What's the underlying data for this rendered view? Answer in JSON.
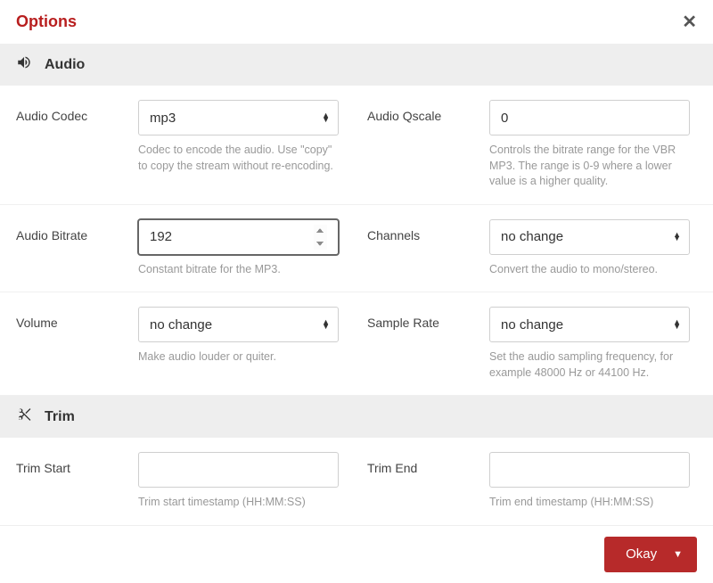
{
  "header": {
    "title": "Options"
  },
  "audio": {
    "section_label": "Audio",
    "codec": {
      "label": "Audio Codec",
      "value": "mp3",
      "help": "Codec to encode the audio. Use \"copy\" to copy the stream without re-encoding."
    },
    "qscale": {
      "label": "Audio Qscale",
      "value": "0",
      "help": "Controls the bitrate range for the VBR MP3. The range is 0-9 where a lower value is a higher quality."
    },
    "bitrate": {
      "label": "Audio Bitrate",
      "value": "192",
      "help": "Constant bitrate for the MP3."
    },
    "channels": {
      "label": "Channels",
      "value": "no change",
      "help": "Convert the audio to mono/stereo."
    },
    "volume": {
      "label": "Volume",
      "value": "no change",
      "help": "Make audio louder or quiter."
    },
    "samplerate": {
      "label": "Sample Rate",
      "value": "no change",
      "help": "Set the audio sampling frequency, for example 48000 Hz or 44100 Hz."
    }
  },
  "trim": {
    "section_label": "Trim",
    "start": {
      "label": "Trim Start",
      "value": "",
      "help": "Trim start timestamp (HH:MM:SS)"
    },
    "end": {
      "label": "Trim End",
      "value": "",
      "help": "Trim end timestamp (HH:MM:SS)"
    }
  },
  "footer": {
    "okay_label": "Okay"
  }
}
